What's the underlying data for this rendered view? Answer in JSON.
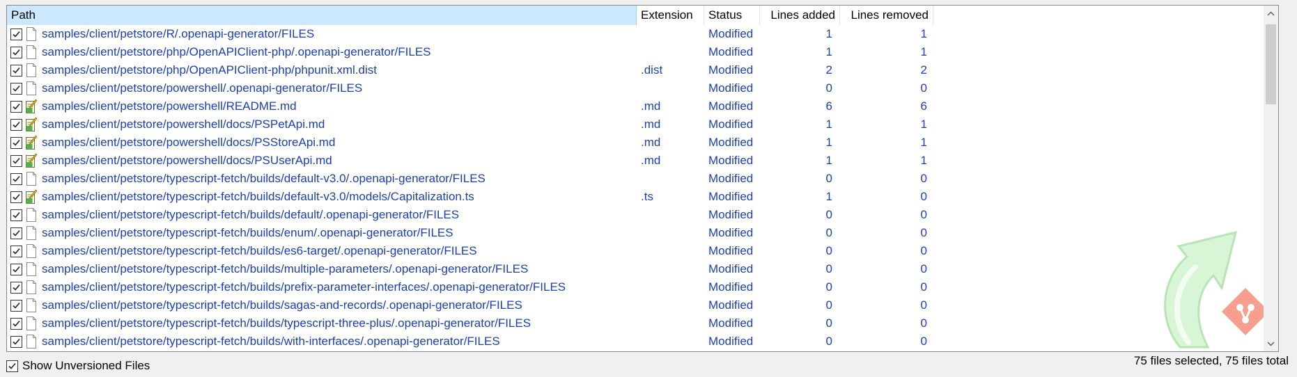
{
  "columns": {
    "path": "Path",
    "extension": "Extension",
    "status": "Status",
    "lines_added": "Lines added",
    "lines_removed": "Lines removed"
  },
  "rows": [
    {
      "path": "samples/client/petstore/R/.openapi-generator/FILES",
      "ext": "",
      "status": "Modified",
      "added": "1",
      "removed": "1",
      "icon": "file-icon",
      "checked": true
    },
    {
      "path": "samples/client/petstore/php/OpenAPIClient-php/.openapi-generator/FILES",
      "ext": "",
      "status": "Modified",
      "added": "1",
      "removed": "1",
      "icon": "file-icon",
      "checked": true
    },
    {
      "path": "samples/client/petstore/php/OpenAPIClient-php/phpunit.xml.dist",
      "ext": ".dist",
      "status": "Modified",
      "added": "2",
      "removed": "2",
      "icon": "file-icon",
      "checked": true
    },
    {
      "path": "samples/client/petstore/powershell/.openapi-generator/FILES",
      "ext": "",
      "status": "Modified",
      "added": "0",
      "removed": "0",
      "icon": "file-icon",
      "checked": true
    },
    {
      "path": "samples/client/petstore/powershell/README.md",
      "ext": ".md",
      "status": "Modified",
      "added": "6",
      "removed": "6",
      "icon": "text-file-icon",
      "checked": true
    },
    {
      "path": "samples/client/petstore/powershell/docs/PSPetApi.md",
      "ext": ".md",
      "status": "Modified",
      "added": "1",
      "removed": "1",
      "icon": "text-file-icon",
      "checked": true
    },
    {
      "path": "samples/client/petstore/powershell/docs/PSStoreApi.md",
      "ext": ".md",
      "status": "Modified",
      "added": "1",
      "removed": "1",
      "icon": "text-file-icon",
      "checked": true
    },
    {
      "path": "samples/client/petstore/powershell/docs/PSUserApi.md",
      "ext": ".md",
      "status": "Modified",
      "added": "1",
      "removed": "1",
      "icon": "text-file-icon",
      "checked": true
    },
    {
      "path": "samples/client/petstore/typescript-fetch/builds/default-v3.0/.openapi-generator/FILES",
      "ext": "",
      "status": "Modified",
      "added": "0",
      "removed": "0",
      "icon": "file-icon",
      "checked": true
    },
    {
      "path": "samples/client/petstore/typescript-fetch/builds/default-v3.0/models/Capitalization.ts",
      "ext": ".ts",
      "status": "Modified",
      "added": "1",
      "removed": "0",
      "icon": "text-file-icon",
      "checked": true
    },
    {
      "path": "samples/client/petstore/typescript-fetch/builds/default/.openapi-generator/FILES",
      "ext": "",
      "status": "Modified",
      "added": "0",
      "removed": "0",
      "icon": "file-icon",
      "checked": true
    },
    {
      "path": "samples/client/petstore/typescript-fetch/builds/enum/.openapi-generator/FILES",
      "ext": "",
      "status": "Modified",
      "added": "0",
      "removed": "0",
      "icon": "file-icon",
      "checked": true
    },
    {
      "path": "samples/client/petstore/typescript-fetch/builds/es6-target/.openapi-generator/FILES",
      "ext": "",
      "status": "Modified",
      "added": "0",
      "removed": "0",
      "icon": "file-icon",
      "checked": true
    },
    {
      "path": "samples/client/petstore/typescript-fetch/builds/multiple-parameters/.openapi-generator/FILES",
      "ext": "",
      "status": "Modified",
      "added": "0",
      "removed": "0",
      "icon": "file-icon",
      "checked": true
    },
    {
      "path": "samples/client/petstore/typescript-fetch/builds/prefix-parameter-interfaces/.openapi-generator/FILES",
      "ext": "",
      "status": "Modified",
      "added": "0",
      "removed": "0",
      "icon": "file-icon",
      "checked": true
    },
    {
      "path": "samples/client/petstore/typescript-fetch/builds/sagas-and-records/.openapi-generator/FILES",
      "ext": "",
      "status": "Modified",
      "added": "0",
      "removed": "0",
      "icon": "file-icon",
      "checked": true
    },
    {
      "path": "samples/client/petstore/typescript-fetch/builds/typescript-three-plus/.openapi-generator/FILES",
      "ext": "",
      "status": "Modified",
      "added": "0",
      "removed": "0",
      "icon": "file-icon",
      "checked": true
    },
    {
      "path": "samples/client/petstore/typescript-fetch/builds/with-interfaces/.openapi-generator/FILES",
      "ext": "",
      "status": "Modified",
      "added": "0",
      "removed": "0",
      "icon": "file-icon",
      "checked": true
    }
  ],
  "footer": {
    "show_unversioned_label": "Show Unversioned Files",
    "show_unversioned_checked": true,
    "selection_status": "75 files selected, 75 files total"
  },
  "scrollbar": {
    "up_icon": "chevron-up-icon",
    "down_icon": "chevron-down-icon"
  },
  "colors": {
    "row_text": "#1a3fb0",
    "header_selected_bg": "#cce8ff",
    "watermark_green": "#6fd36a",
    "watermark_git": "#f05133"
  }
}
